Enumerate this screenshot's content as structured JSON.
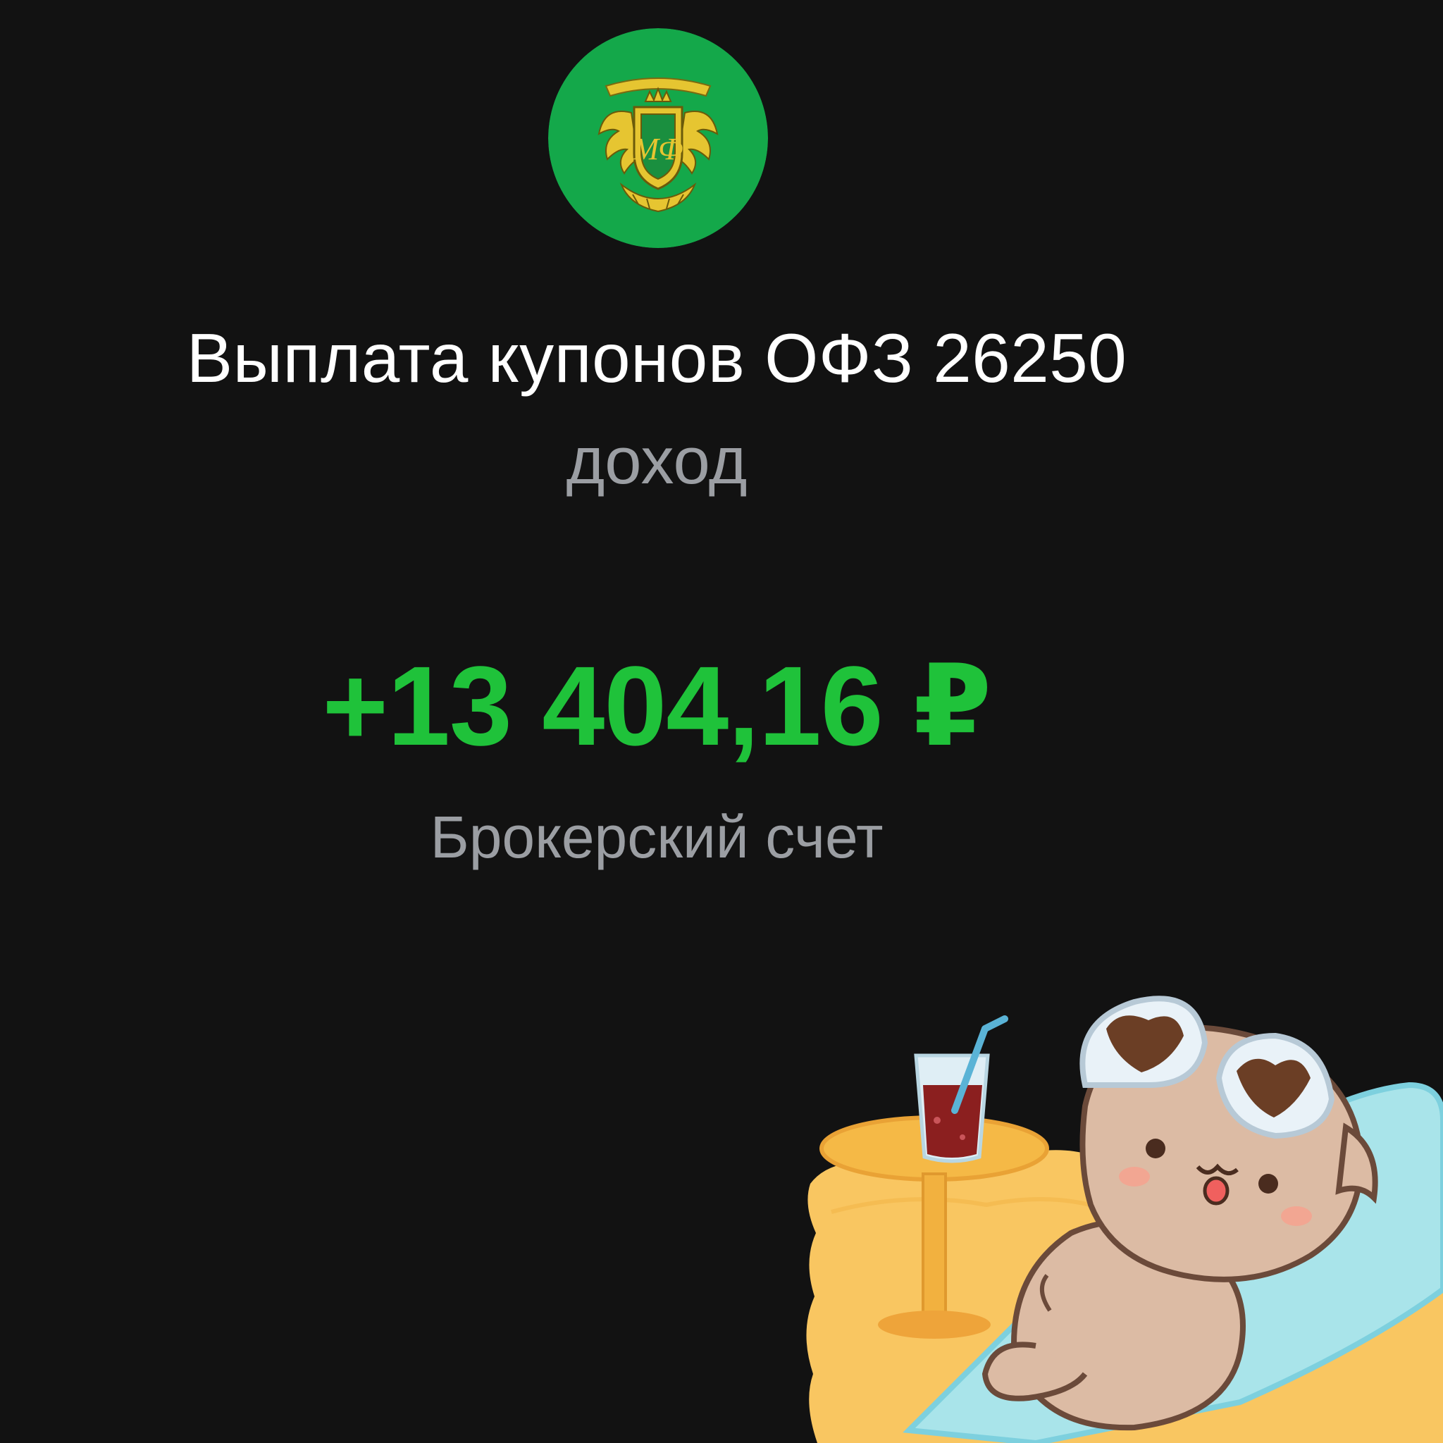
{
  "operation": {
    "title": "Выплата купонов ОФЗ 26250",
    "category": "доход",
    "amount": "+13 404,16 ₽",
    "account": "Брокерский счет"
  },
  "logo": {
    "icon": "minfin-emblem-icon",
    "bg_color": "#14a84a",
    "emblem_color": "#e6c531"
  },
  "sticker": {
    "icon": "cat-sunbathing-sticker"
  },
  "colors": {
    "background": "#121212",
    "amount": "#1fc23a",
    "secondary_text": "#9b9ea3",
    "primary_text": "#ffffff"
  }
}
